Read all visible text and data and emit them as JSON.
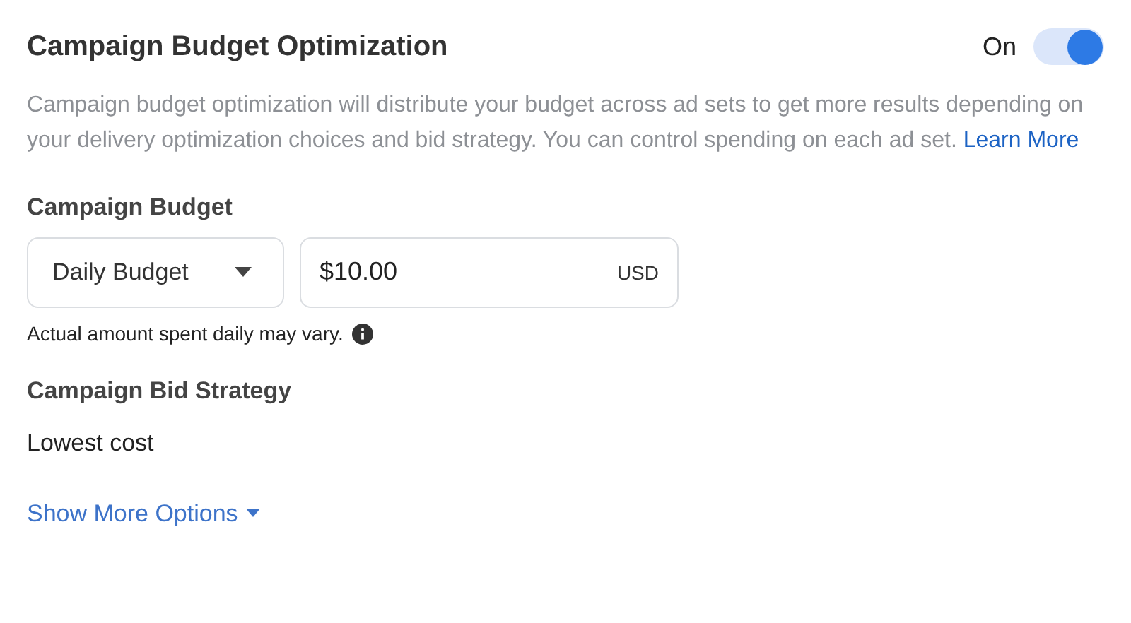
{
  "title": "Campaign Budget Optimization",
  "toggle": {
    "label": "On",
    "on": true
  },
  "description": {
    "text": "Campaign budget optimization will distribute your budget across ad sets to get more results depending on your delivery optimization choices and bid strategy. You can control spending on each ad set.",
    "link": "Learn More"
  },
  "budget": {
    "heading": "Campaign Budget",
    "type_dropdown": "Daily Budget",
    "amount": "$10.00",
    "currency": "USD",
    "note": "Actual amount spent daily may vary."
  },
  "bid_strategy": {
    "heading": "Campaign Bid Strategy",
    "value": "Lowest cost"
  },
  "more_options": "Show More Options"
}
